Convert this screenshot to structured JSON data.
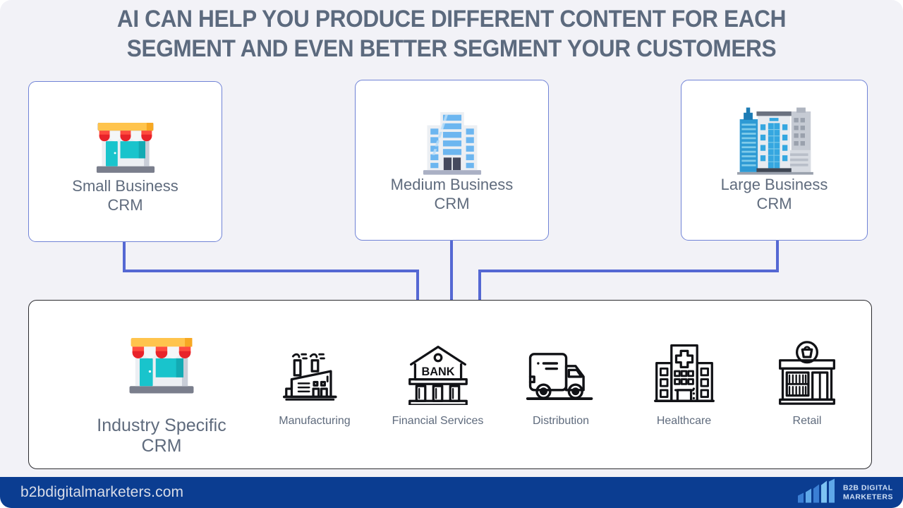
{
  "page": {
    "title": "AI CAN HELP YOU PRODUCE DIFFERENT CONTENT FOR EACH\nSEGMENT AND EVEN BETTER SEGMENT YOUR CUSTOMERS",
    "background_color": "#f2f2f7",
    "accent_color": "#5568d3",
    "text_color": "#5f6b7d"
  },
  "segments": [
    {
      "label": "Small Business\nCRM",
      "icon": "storefront-icon"
    },
    {
      "label": "Medium Business\nCRM",
      "icon": "office-building-icon"
    },
    {
      "label": "Large Business\nCRM",
      "icon": "city-skyline-icon"
    }
  ],
  "industry_panel": {
    "label": "Industry Specific\nCRM",
    "icon": "storefront-icon",
    "items": [
      {
        "label": "Manufacturing",
        "icon": "factory-icon"
      },
      {
        "label": "Financial Services",
        "icon": "bank-icon"
      },
      {
        "label": "Distribution",
        "icon": "delivery-truck-icon"
      },
      {
        "label": "Healthcare",
        "icon": "hospital-icon"
      },
      {
        "label": "Retail",
        "icon": "retail-shop-icon"
      }
    ]
  },
  "footer": {
    "url": "b2bdigitalmarketers.com",
    "logo_text": "B2B DIGITAL\nMARKETERS",
    "background_color": "#0b3d91",
    "logo_icon": "bar-chart-logo-icon"
  }
}
